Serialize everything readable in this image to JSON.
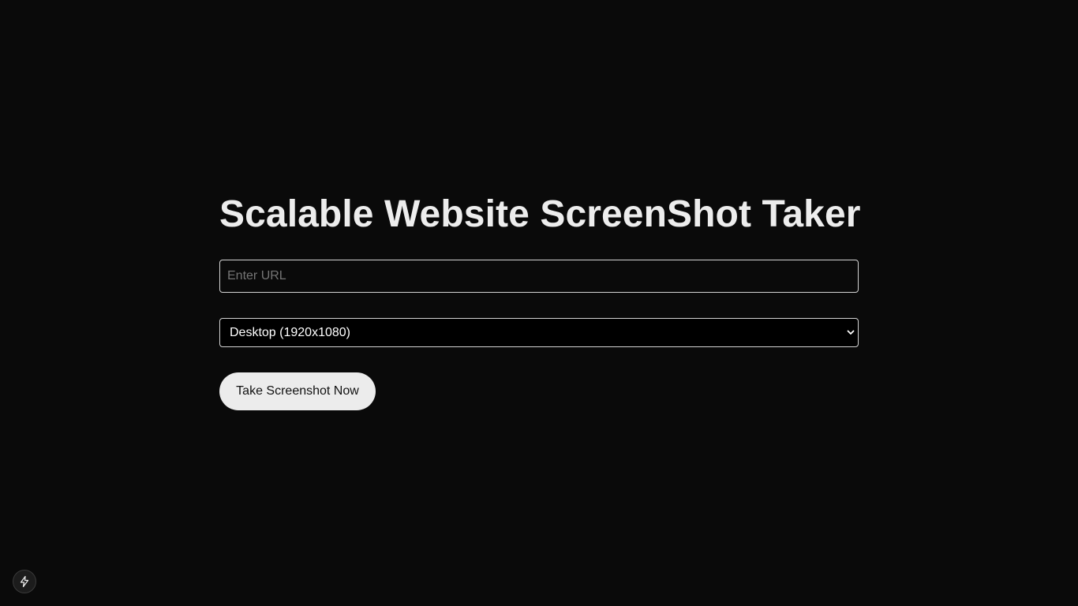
{
  "header": {
    "title": "Scalable Website ScreenShot Taker"
  },
  "form": {
    "url_input": {
      "placeholder": "Enter URL",
      "value": ""
    },
    "device_select": {
      "selected": "Desktop (1920x1080)"
    },
    "submit_label": "Take Screenshot Now"
  },
  "dev_indicator": {
    "icon": "lightning-bolt-icon"
  }
}
